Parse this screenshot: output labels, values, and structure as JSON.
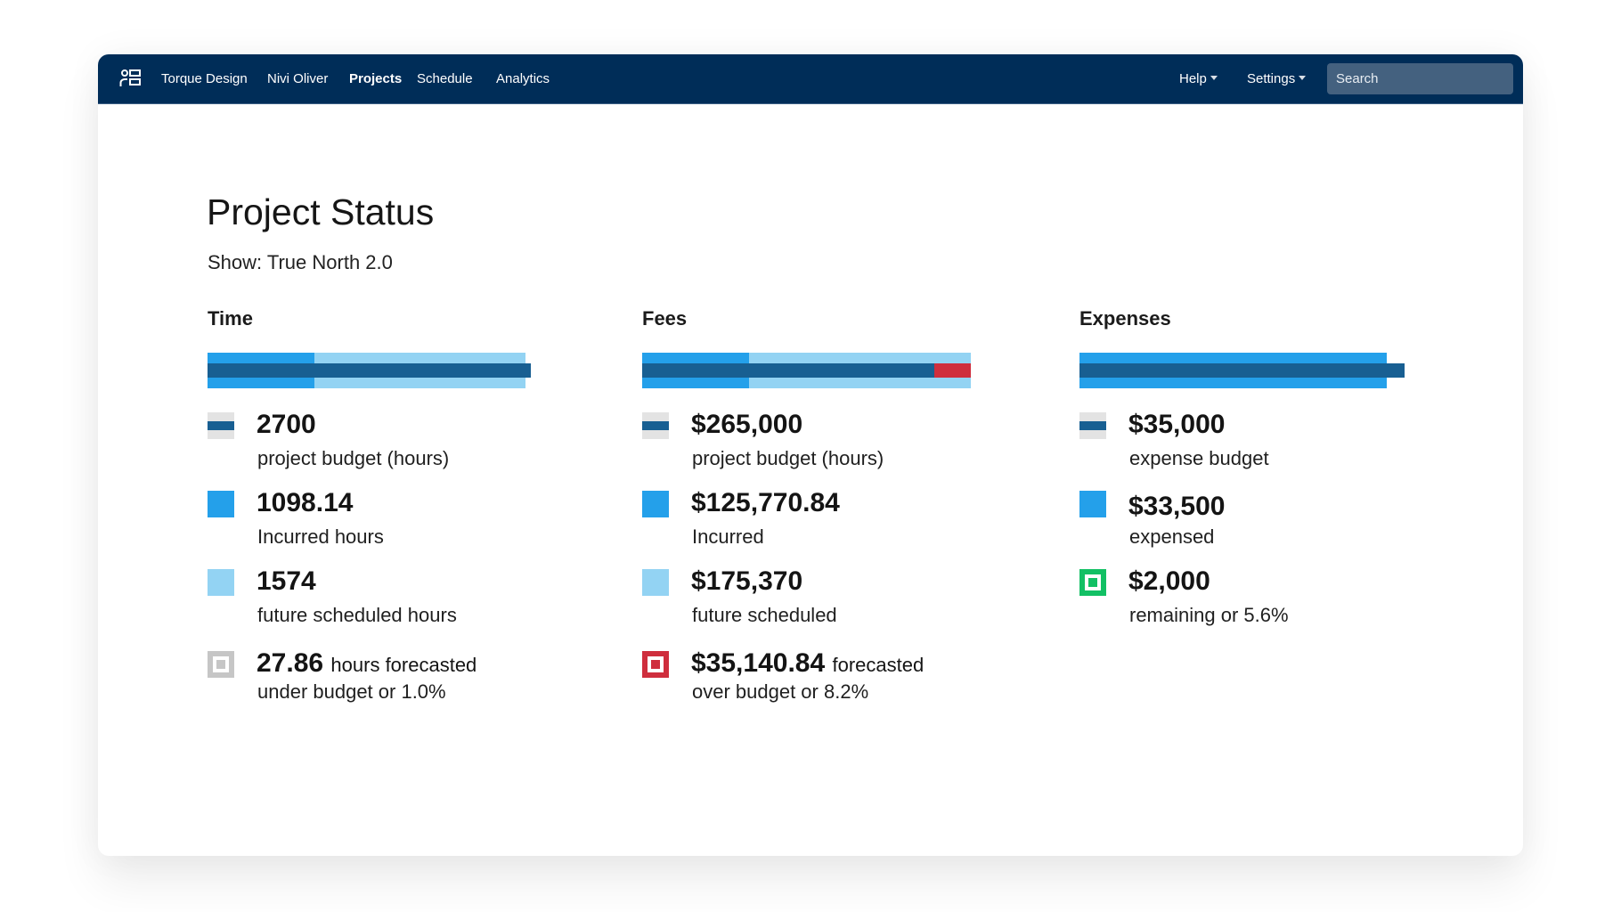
{
  "nav": {
    "logo_icon": "contacts-icon",
    "items": [
      {
        "label": "Torque Design",
        "active": false
      },
      {
        "label": "Nivi Oliver",
        "active": false
      },
      {
        "label": "Projects",
        "active": true
      },
      {
        "label": "Schedule",
        "active": false
      },
      {
        "label": "Analytics",
        "active": false
      }
    ],
    "help_label": "Help",
    "settings_label": "Settings",
    "search_placeholder": "Search"
  },
  "page": {
    "title": "Project Status",
    "show_filter": "Show: True North 2.0"
  },
  "colors": {
    "nav_bg": "#002d58",
    "budget": "#185f92",
    "incurred": "#24a0ea",
    "future": "#93d3f3",
    "over_budget": "#cf2e3d",
    "under_budget_neutral": "#c6c6c6",
    "remaining": "#12c064"
  },
  "columns": {
    "time": {
      "title": "Time",
      "bar": {
        "incurred_fraction": 0.331,
        "future_end_fraction": 0.983,
        "budget_fraction": 1.0,
        "over_start_fraction": null
      },
      "budget": {
        "value": "2700",
        "label": "project budget (hours)"
      },
      "incurred": {
        "value": "1098.14",
        "label": "Incurred hours"
      },
      "future": {
        "value": "1574",
        "label": "future scheduled hours"
      },
      "forecast": {
        "value": "27.86",
        "suffix": "hours forecasted",
        "label": "under budget or 1.0%",
        "status": "under"
      }
    },
    "fees": {
      "title": "Fees",
      "bar": {
        "incurred_fraction": 0.325,
        "future_end_fraction": 1.0,
        "budget_fraction": 0.889,
        "over_start_fraction": 0.889
      },
      "budget": {
        "value": "$265,000",
        "label": "project budget (hours)"
      },
      "incurred": {
        "value": "$125,770.84",
        "label": "Incurred"
      },
      "future": {
        "value": "$175,370",
        "label": "future scheduled"
      },
      "forecast": {
        "value": "$35,140.84",
        "suffix": "forecasted",
        "label": "over budget or 8.2%",
        "status": "over"
      }
    },
    "expenses": {
      "title": "Expenses",
      "bar": {
        "incurred_fraction": 0.945,
        "future_end_fraction": 0.945,
        "budget_fraction": 1.0,
        "over_start_fraction": null
      },
      "budget": {
        "value": "$35,000",
        "label": "expense budget"
      },
      "incurred": {
        "value": "$33,500",
        "label": "expensed"
      },
      "remaining": {
        "value": "$2,000",
        "label": "remaining or 5.6%",
        "status": "remaining"
      }
    }
  }
}
